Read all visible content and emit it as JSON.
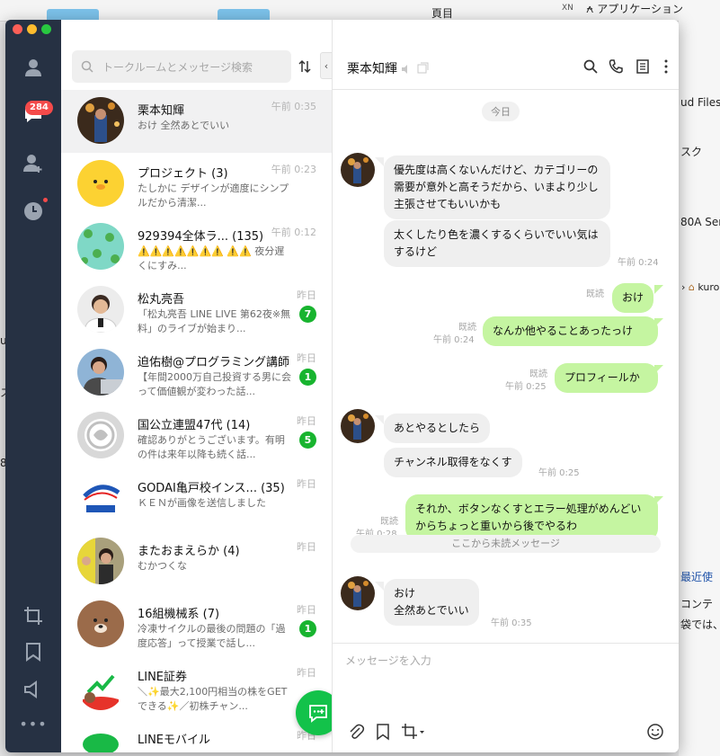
{
  "background": {
    "app_menu_label": "アプリケーション",
    "right_texts": [
      "頁目",
      "ud Files",
      "スク",
      "80A Ser",
      "kuro",
      "最近使",
      "コンテ",
      "袋では、"
    ],
    "left_texts": [
      "u",
      "ス",
      "8"
    ],
    "top_icon_text": "XN"
  },
  "nav": {
    "chats_badge": "284",
    "colors": {
      "sidebar": "#263143",
      "badge": "#f44a4a",
      "line_green": "#18b42f"
    }
  },
  "search": {
    "placeholder": "トークルームとメッセージ検索"
  },
  "chats": [
    {
      "name": "栗本知輝",
      "preview": "おけ 全然あとでいい",
      "time": "午前 0:35",
      "unread": "",
      "avatar": "night-photo"
    },
    {
      "name": "プロジェクト (3)",
      "preview": "たしかに デザインが適度にシンプルだから清潔...",
      "time": "午前 0:23",
      "unread": "",
      "avatar": "sally-character"
    },
    {
      "name": "929394全体ラ... (135)",
      "preview": "⚠️⚠️⚠️⚠️⚠️⚠️⚠️ ⚠️⚠️ 夜分遅くにすみ...",
      "time": "午前 0:12",
      "unread": "",
      "avatar": "frog-pattern"
    },
    {
      "name": "松丸亮吾",
      "preview": "「松丸亮吾 LINE LIVE 第62夜※無料」のライブが始まり...",
      "time": "昨日",
      "unread": "7",
      "avatar": "person-white"
    },
    {
      "name": "迫佑樹@プログラミング講師",
      "preview": "【年間2000万自己投資する男に会って価値観が変わった話...",
      "time": "昨日",
      "unread": "1",
      "avatar": "person-laptop"
    },
    {
      "name": "国公立連盟47代 (14)",
      "preview": "確認ありがとうございます。有明の件は来年以降も続く話...",
      "time": "昨日",
      "unread": "5",
      "avatar": "grey-logo"
    },
    {
      "name": "GODAI亀戸校インス...  (35)",
      "preview": "ＫＥＮが画像を送信しました",
      "time": "昨日",
      "unread": "",
      "avatar": "godai-logo"
    },
    {
      "name": "またおまえらか (4)",
      "preview": "むかつくな",
      "time": "昨日",
      "unread": "",
      "avatar": "group-photo"
    },
    {
      "name": "16組機械系 (7)",
      "preview": "冷凍サイクルの最後の問題の「過度応答」って授業で話し...",
      "time": "昨日",
      "unread": "1",
      "avatar": "brown-bear"
    },
    {
      "name": "LINE証券",
      "preview": "＼✨最大2,100円相当の株をGETできる✨／初株チャン...",
      "time": "昨日",
      "unread": "",
      "avatar": "line-securities"
    },
    {
      "name": "LINEモバイル",
      "preview": "",
      "time": "昨日",
      "unread": "",
      "avatar": "line-mobile"
    }
  ],
  "conversation": {
    "title": "栗本知輝",
    "date_label": "今日",
    "messages": [
      {
        "dir": "in",
        "text": "優先度は高くないんだけど、カテゴリーの需要が意外と高そうだから、いまより少し主張させてもいいかも",
        "time": ""
      },
      {
        "dir": "in",
        "text": "太くしたり色を濃くするくらいでいい気はするけど",
        "time": "午前 0:24"
      },
      {
        "dir": "out",
        "text": "おけ",
        "read": "既読",
        "time": ""
      },
      {
        "dir": "out",
        "text": "なんか他やることあったっけ",
        "read": "既読",
        "time": "午前 0:24"
      },
      {
        "dir": "out",
        "text": "プロフィールか",
        "read": "既読",
        "time": "午前 0:25"
      },
      {
        "dir": "in",
        "text": "あとやるとしたら",
        "time": ""
      },
      {
        "dir": "in",
        "text": "チャンネル取得をなくす",
        "time": "午前 0:25"
      },
      {
        "dir": "out",
        "text": "それか、ボタンなくすとエラー処理がめんどいからちょっと重いから後でやるわ",
        "read": "既読",
        "time": "午前 0:28"
      },
      {
        "dir": "in",
        "text": "おけ\n全然あとでいい",
        "time": "午前 0:35"
      }
    ],
    "unread_divider": "ここから未読メッセージ"
  },
  "composer": {
    "placeholder": "メッセージを入力"
  }
}
